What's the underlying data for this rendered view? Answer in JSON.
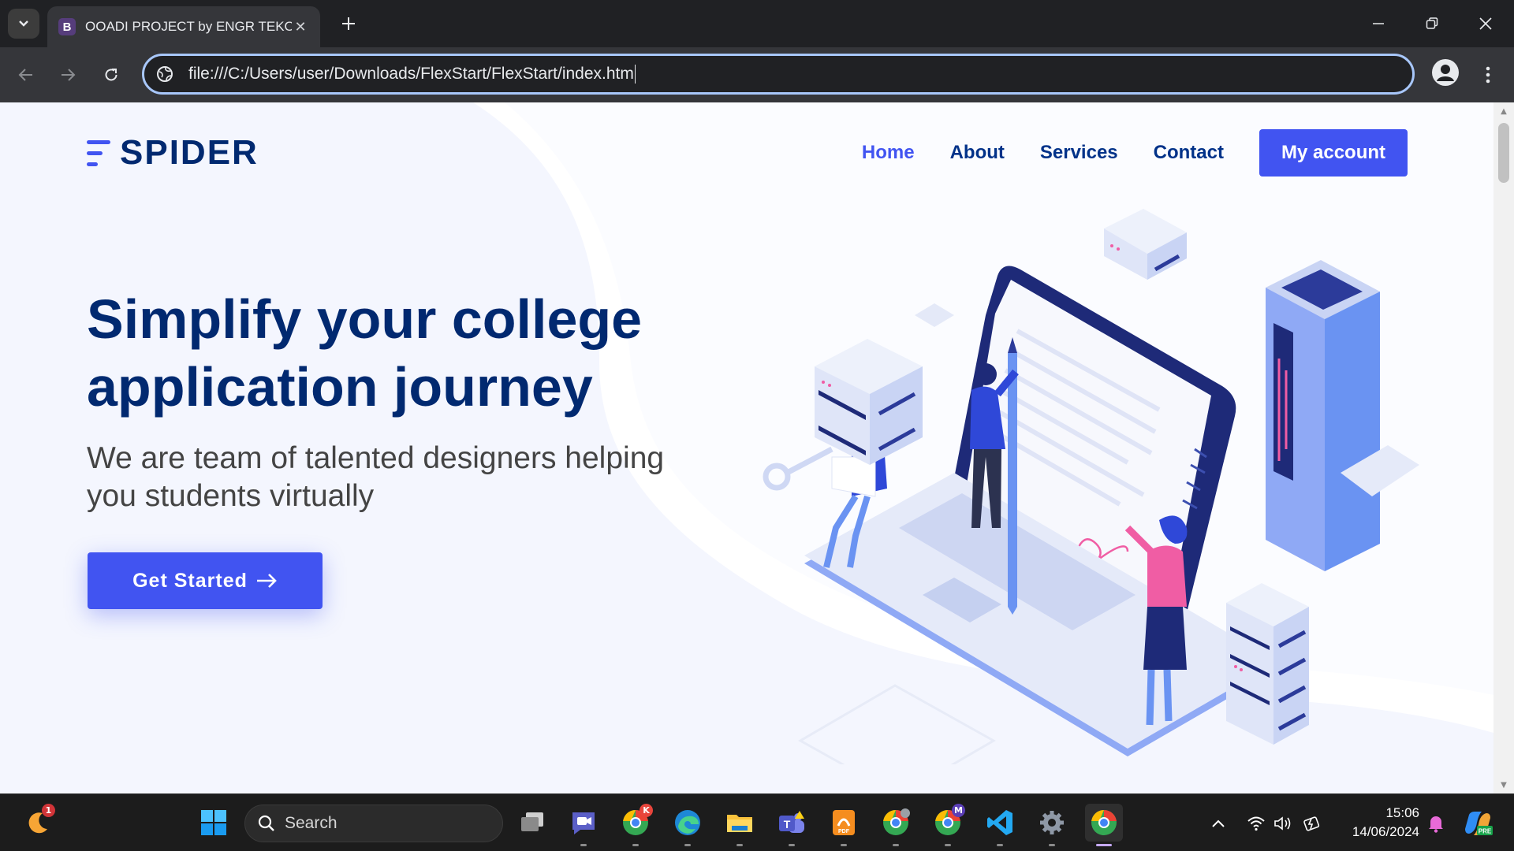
{
  "browser": {
    "tab_title": "OOADI PROJECT by ENGR TEKO",
    "tab_favicon_letter": "B",
    "address": "file:///C:/Users/user/Downloads/FlexStart/FlexStart/index.htm"
  },
  "site": {
    "logo_text": "SPIDER",
    "nav": [
      {
        "label": "Home",
        "active": true
      },
      {
        "label": "About"
      },
      {
        "label": "Services"
      },
      {
        "label": "Contact"
      }
    ],
    "account_label": "My account",
    "hero_title": "Simplify your college application journey",
    "hero_subtitle": "We are team of talented designers helping you students virtually",
    "cta_label": "Get Started",
    "colors": {
      "accent": "#4154f1",
      "heading": "#012970",
      "text": "#444444",
      "hero_bg": "#f4f6fe"
    }
  },
  "taskbar": {
    "search_placeholder": "Search",
    "notification_count": "1",
    "time": "15:06",
    "date": "14/06/2024",
    "badges": {
      "chrome_k": "K",
      "chrome_m": "M",
      "copilot": "PRE"
    },
    "apps": [
      "start-icon",
      "task-view-icon",
      "meet-icon",
      "chrome-icon",
      "edge-icon",
      "file-explorer-icon",
      "teams-icon",
      "pdf-reader-icon",
      "chrome-icon",
      "chrome-icon",
      "vscode-icon",
      "settings-icon",
      "chrome-icon"
    ]
  }
}
